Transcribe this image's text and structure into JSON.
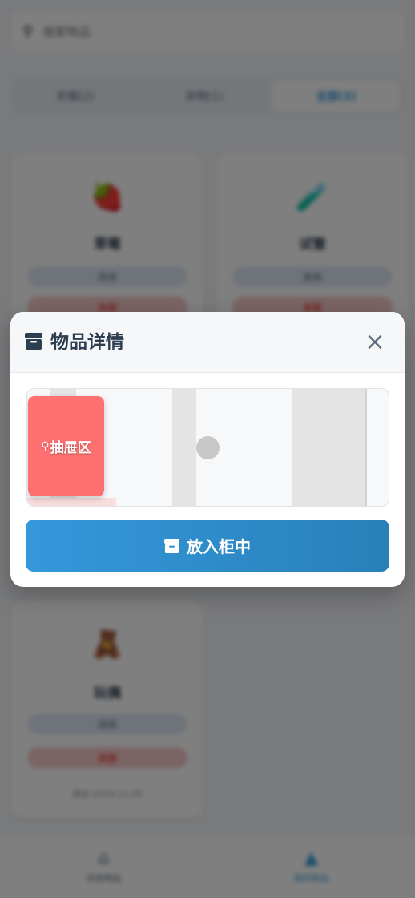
{
  "background": {
    "search": {
      "placeholder": "搜索物品"
    },
    "tabs": [
      {
        "label": "衣服(2)"
      },
      {
        "label": "杂物(1)"
      },
      {
        "label": "全部(3)"
      }
    ],
    "cards": [
      {
        "emoji": "🍓",
        "name": "草莓",
        "tag": "其他",
        "status": "未放"
      },
      {
        "emoji": "🧪",
        "name": "试管",
        "tag": "其他",
        "status": "未放"
      },
      {
        "emoji": "🧸",
        "name": "玩偶",
        "tag": "其他",
        "status": "未放",
        "meta": "添加 2024-11-05"
      }
    ],
    "bottom_nav": [
      {
        "icon": "house-icon",
        "label": "存放物品"
      },
      {
        "icon": "person-icon",
        "label": "我的物品"
      }
    ]
  },
  "modal": {
    "title": "物品详情",
    "close_glyph": "×",
    "drawer_label": "抽屉区",
    "put_button_label": "放入柜中"
  },
  "colors": {
    "accent": "#3498db",
    "accent_dark": "#2980b9",
    "drawer": "#ff7070",
    "title": "#2c3e50"
  }
}
